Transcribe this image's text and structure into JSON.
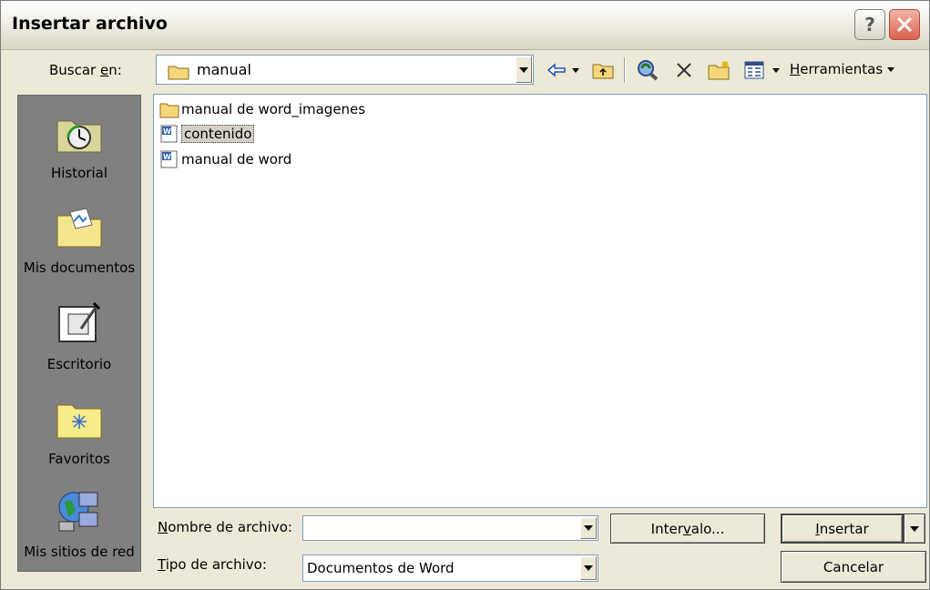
{
  "window": {
    "title": "Insertar archivo"
  },
  "lookin": {
    "label_pre": "Buscar ",
    "label_key": "e",
    "label_post": "n:",
    "value": "manual"
  },
  "toolbar": {
    "tools_key": "H",
    "tools_rest": "erramientas"
  },
  "places": [
    {
      "label": "Historial",
      "icon": "history-icon"
    },
    {
      "label": "Mis documentos",
      "icon": "my-documents-icon"
    },
    {
      "label": "Escritorio",
      "icon": "desktop-icon"
    },
    {
      "label": "Favoritos",
      "icon": "favorites-icon"
    },
    {
      "label": "Mis sitios de red",
      "icon": "network-places-icon"
    }
  ],
  "files": [
    {
      "name": "manual de word_imagenes",
      "type": "folder"
    },
    {
      "name": "contenido",
      "type": "word-doc",
      "selected": true
    },
    {
      "name": "manual de word",
      "type": "word-doc"
    }
  ],
  "filename": {
    "label_key": "N",
    "label_rest": "ombre de archivo:",
    "value": ""
  },
  "filetype": {
    "label_key": "T",
    "label_rest": "ipo de archivo:",
    "value": "Documentos de Word"
  },
  "buttons": {
    "interval_pre": "Inter",
    "interval_key": "v",
    "interval_post": "alo...",
    "insert_key": "I",
    "insert_rest": "nsertar",
    "cancel": "Cancelar"
  },
  "colors": {
    "places_bg": "#808080",
    "dialog_bg": "#ece9d8",
    "close_red": "#d8614f"
  }
}
